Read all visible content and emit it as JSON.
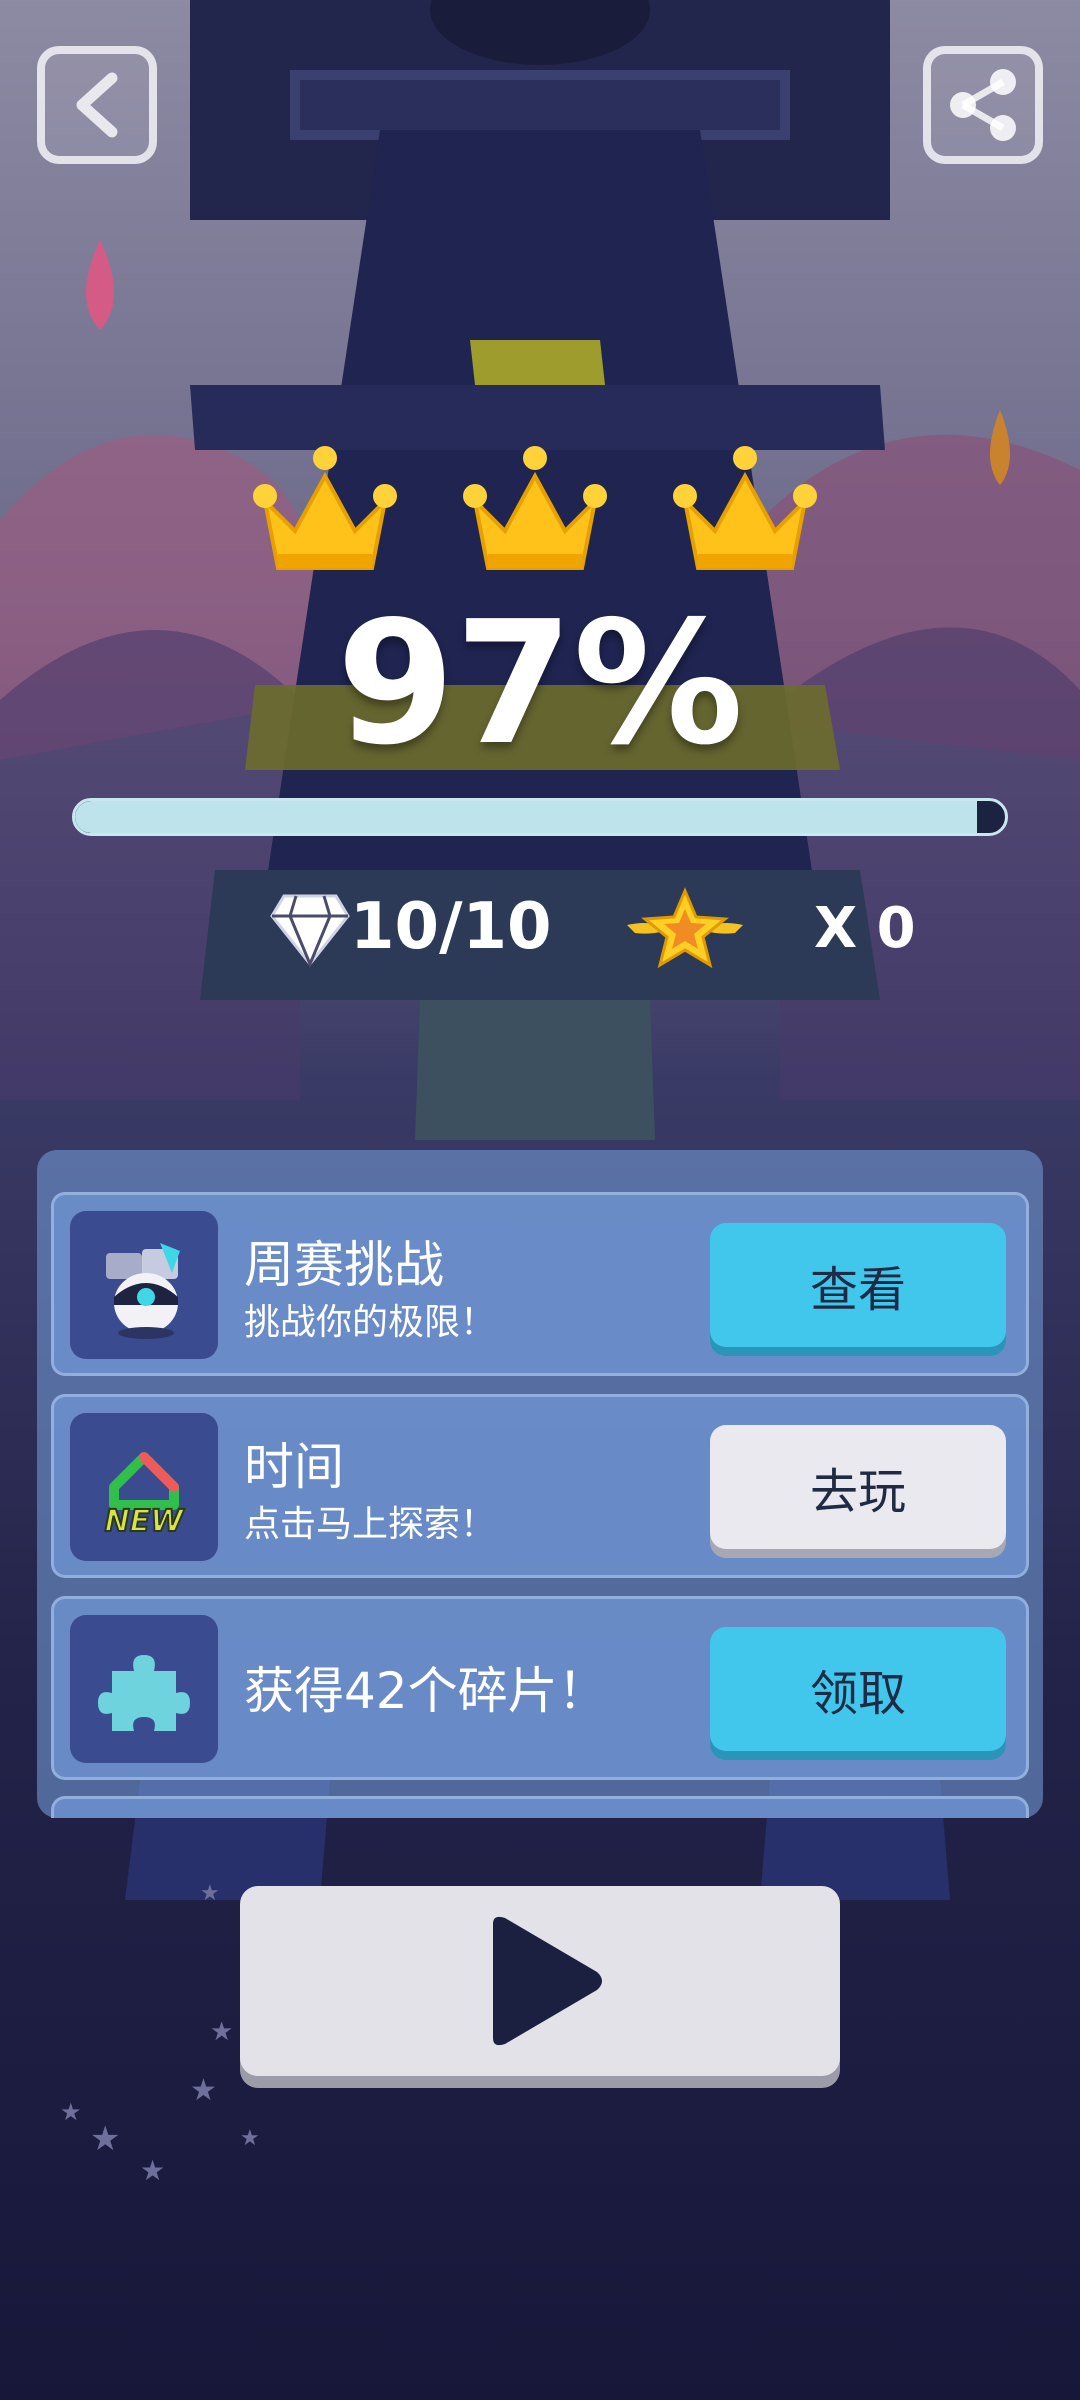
{
  "result": {
    "crowns_earned": 3,
    "percent_text": "97%",
    "progress": 0.97,
    "gems_text": "10/10",
    "stars_text": "X 0"
  },
  "icons": {
    "back": "back-arrow-icon",
    "share": "share-icon",
    "crown": "crown-icon",
    "gem": "diamond-icon",
    "star": "winged-star-icon",
    "play": "play-icon"
  },
  "offers": [
    {
      "title": "周赛挑战",
      "subtitle": "挑战你的极限！",
      "button": "查看",
      "icon": "robot-icon"
    },
    {
      "title": "时间",
      "subtitle": "点击马上探索！",
      "button": "去玩",
      "icon": "new-house-icon",
      "badge": "NEW"
    },
    {
      "title": "获得42个碎片！",
      "button": "领取",
      "icon": "puzzle-piece-icon"
    }
  ],
  "colors": {
    "accent_blue": "#41c6ec",
    "gold": "#ffc21a",
    "panel": "#7094ce"
  }
}
